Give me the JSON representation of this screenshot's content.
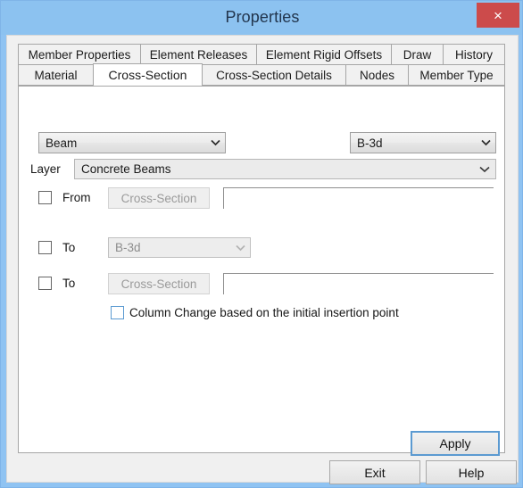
{
  "window": {
    "title": "Properties",
    "close_label": "×",
    "close_icon": "close-icon",
    "titlebar_color": "#8cc2f0",
    "close_button_color": "#cc4b4b",
    "border_color": "#7fb4e8"
  },
  "tabs": {
    "top_row": [
      {
        "label": "Member Properties",
        "selected": false
      },
      {
        "label": "Element Releases",
        "selected": false
      },
      {
        "label": "Element Rigid Offsets",
        "selected": false
      },
      {
        "label": "Draw",
        "selected": false
      },
      {
        "label": "History",
        "selected": false
      }
    ],
    "bottom_row": [
      {
        "label": "Material",
        "selected": false
      },
      {
        "label": "Cross-Section",
        "selected": true
      },
      {
        "label": "Cross-Section Details",
        "selected": false
      },
      {
        "label": "Nodes",
        "selected": false
      },
      {
        "label": "Member Type",
        "selected": false
      }
    ]
  },
  "form": {
    "member_type_combo": {
      "value": "Beam",
      "icon": "chevron-down-icon",
      "enabled": true
    },
    "section_combo": {
      "value": "B-3d",
      "icon": "chevron-down-icon",
      "enabled": true
    },
    "layer": {
      "label": "Layer",
      "value": "Concrete Beams",
      "icon": "chevron-down-icon",
      "enabled": true
    },
    "rows": [
      {
        "checkbox_checked": false,
        "label": "From",
        "button_label": "Cross-Section",
        "button_enabled": false,
        "input_value": "",
        "control": "button"
      },
      {
        "checkbox_checked": false,
        "label": "To",
        "combo_value": "B-3d",
        "combo_enabled": false,
        "icon": "chevron-down-icon",
        "control": "combo"
      },
      {
        "checkbox_checked": false,
        "label": "To",
        "button_label": "Cross-Section",
        "button_enabled": false,
        "input_value": "",
        "control": "button"
      }
    ],
    "column_change": {
      "label": "Column Change based on the initial insertion point",
      "checked": false,
      "accent_color": "#5b9ad1"
    },
    "apply_button": {
      "label": "Apply",
      "focused": true
    }
  },
  "footer": {
    "exit_label": "Exit",
    "help_label": "Help"
  }
}
